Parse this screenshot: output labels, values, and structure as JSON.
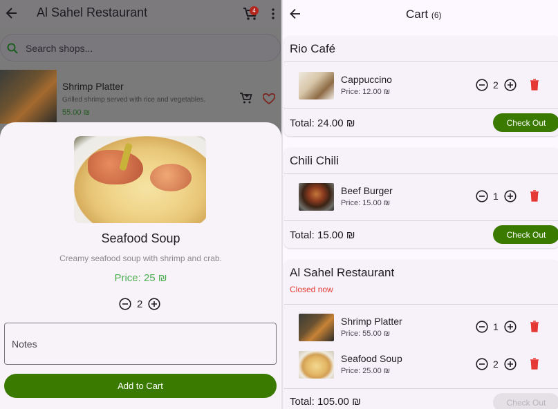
{
  "left": {
    "appbar": {
      "title": "Al Sahel Restaurant",
      "cart_badge": "4"
    },
    "search": {
      "placeholder": "Search shops..."
    },
    "list_item": {
      "name": "Shrimp Platter",
      "description": "Grilled shrimp served with rice and vegetables.",
      "price": "55.00 ₪"
    },
    "sheet": {
      "title": "Seafood Soup",
      "description": "Creamy seafood soup with shrimp and crab.",
      "price": "Price: 25 ₪",
      "quantity": "2",
      "notes_placeholder": "Notes",
      "add_button": "Add to Cart"
    }
  },
  "cart": {
    "title": "Cart",
    "count": "(6)",
    "shops": [
      {
        "name": "Rio Café",
        "status": "",
        "items": [
          {
            "name": "Cappuccino",
            "price": "Price: 12.00 ₪",
            "qty": "2"
          }
        ],
        "total": "Total: 24.00 ₪",
        "checkout_label": "Check Out",
        "checkout_enabled": true
      },
      {
        "name": "Chili Chili",
        "status": "",
        "items": [
          {
            "name": "Beef Burger",
            "price": "Price: 15.00 ₪",
            "qty": "1"
          }
        ],
        "total": "Total: 15.00 ₪",
        "checkout_label": "Check Out",
        "checkout_enabled": true
      },
      {
        "name": "Al Sahel Restaurant",
        "status": "Closed now",
        "items": [
          {
            "name": "Shrimp Platter",
            "price": "Price: 55.00 ₪",
            "qty": "1"
          },
          {
            "name": "Seafood Soup",
            "price": "Price: 25.00 ₪",
            "qty": "2"
          }
        ],
        "total": "Total: 105.00 ₪",
        "checkout_label": "Check Out",
        "checkout_enabled": false
      }
    ]
  },
  "colors": {
    "primary_green": "#3b7a00",
    "price_green": "#4caf50",
    "delete_red": "#e53935",
    "badge_red": "#b3261e"
  }
}
